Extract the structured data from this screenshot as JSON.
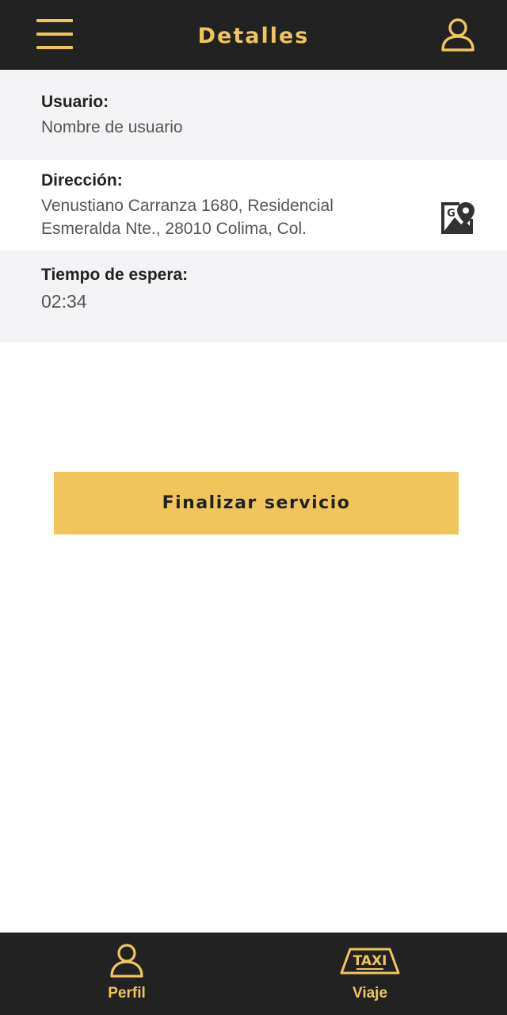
{
  "header": {
    "title": "Detalles",
    "menu_icon": "hamburger-menu-icon",
    "profile_icon": "user-profile-icon"
  },
  "details": {
    "user_label": "Usuario:",
    "user_value": "Nombre de usuario",
    "address_label": "Dirección:",
    "address_line1": "Venustiano Carranza 1680, Residencial",
    "address_line2": "Esmeralda Nte., 28010 Colima, Col.",
    "map_icon": "google-maps-icon",
    "wait_label": "Tiempo de espera:",
    "wait_value": "02:34"
  },
  "actions": {
    "finish_label": "Finalizar servicio"
  },
  "bottom_nav": {
    "items": [
      {
        "label": "Perfil",
        "icon": "user-icon"
      },
      {
        "label": "Viaje",
        "icon": "taxi-sign-icon"
      }
    ]
  },
  "colors": {
    "bar_background": "#222222",
    "accent": "#f0c55c",
    "row_alt": "#f3f2f5"
  }
}
